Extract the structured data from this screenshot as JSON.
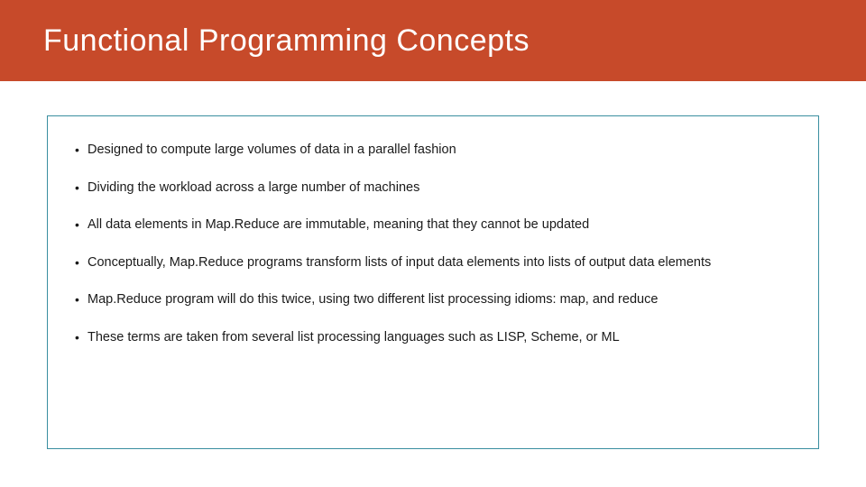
{
  "slide": {
    "title": "Functional Programming Concepts",
    "bullets": [
      "Designed to compute large volumes of data in a parallel fashion",
      "Dividing the workload across a large number of machines",
      "All data elements in Map.Reduce are immutable, meaning that they cannot be updated",
      "Conceptually, Map.Reduce programs transform lists of input data elements into lists of output data elements",
      "Map.Reduce program will do this twice, using two different list processing idioms: map, and reduce",
      "These terms are taken from several list processing languages such as LISP, Scheme, or ML"
    ]
  }
}
